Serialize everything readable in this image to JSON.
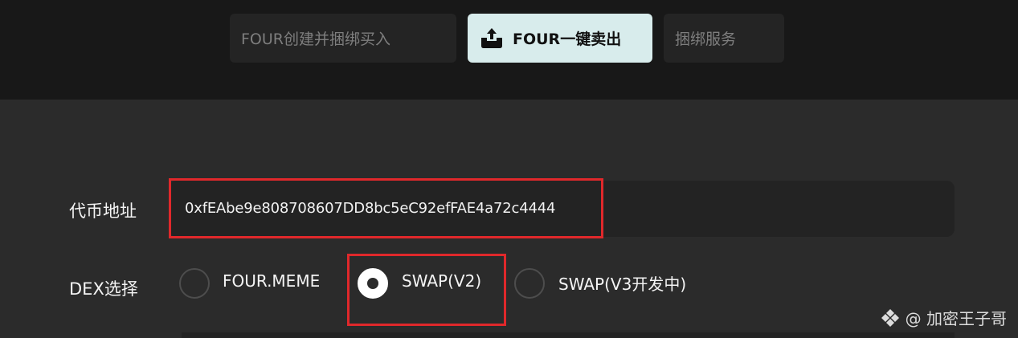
{
  "tabs": [
    {
      "label": "FOUR创建并捆绑买入",
      "active": false
    },
    {
      "label": "FOUR一键卖出",
      "active": true,
      "icon": "upload-tray-icon"
    },
    {
      "label": "捆绑服务",
      "active": false
    }
  ],
  "form": {
    "token_address_label": "代币地址",
    "token_address_value": "0xfEAbe9e808708607DD8bc5eC92efFAE4a72c4444",
    "dex_label": "DEX选择",
    "dex_options": [
      {
        "label": "FOUR.MEME",
        "checked": false
      },
      {
        "label": "SWAP(V2)",
        "checked": true
      },
      {
        "label": "SWAP(V3开发中)",
        "checked": false
      }
    ]
  },
  "watermark": {
    "text": "@ 加密王子哥",
    "icon": "diamond-logo-icon"
  },
  "colors": {
    "highlight": "#e0282b",
    "active_tab_bg": "#d8ecec"
  }
}
